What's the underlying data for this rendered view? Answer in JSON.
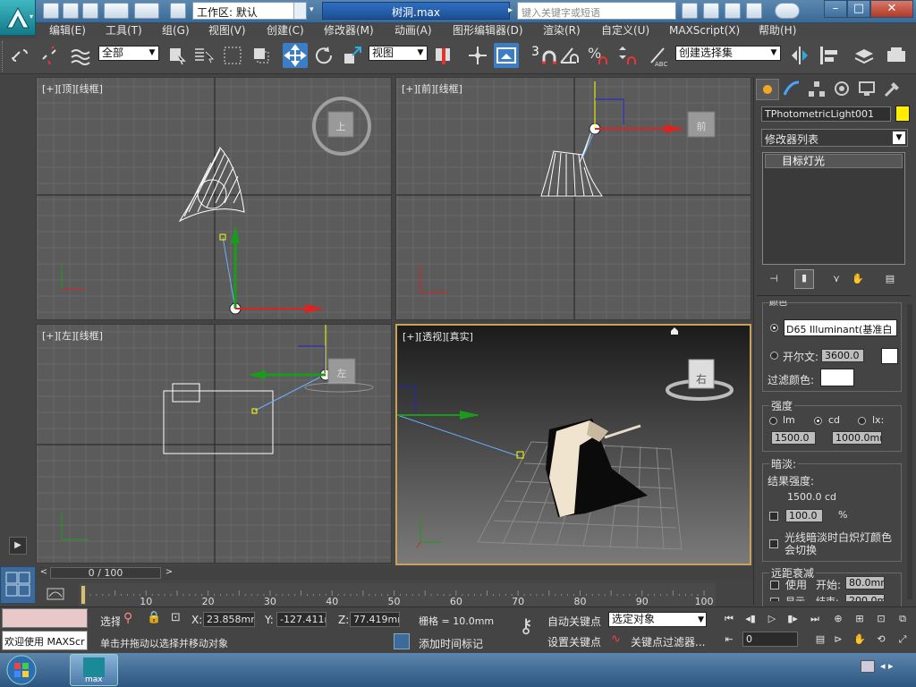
{
  "window": {
    "workspace_label": "工作区: 默认",
    "document_title": "树洞.max",
    "search_placeholder": "键入关键字或短语",
    "min": "–",
    "max": "□",
    "close": "✕"
  },
  "menu": [
    "编辑(E)",
    "工具(T)",
    "组(G)",
    "视图(V)",
    "创建(C)",
    "修改器(M)",
    "动画(A)",
    "图形编辑器(D)",
    "渲染(R)",
    "自定义(U)",
    "MAXScript(X)",
    "帮助(H)"
  ],
  "toolbar": {
    "selection_filter": "全部",
    "reference_coord": "视图",
    "named_selection_set": "创建选择集",
    "snap_number": "3"
  },
  "viewports": {
    "top": {
      "label": "[+][顶][线框]",
      "viewcube": "上"
    },
    "front": {
      "label": "[+][前][线框]",
      "viewcube": "前"
    },
    "left": {
      "label": "[+][左][线框]",
      "viewcube": "左"
    },
    "perspective": {
      "label": "[+][透视][真实]",
      "viewcube": "右"
    }
  },
  "command_panel": {
    "object_name": "TPhotometricLight001",
    "object_color": "#ffee00",
    "modifier_list": "修改器列表",
    "stack_item": "目标灯光",
    "color_rollout": "颜色",
    "preset_color": "D65 Illuminant(基准白",
    "kelvin_label": "开尔文:",
    "kelvin_value": "3600.0",
    "filter_color_label": "过滤颜色:",
    "intensity_rollout": "强度",
    "unit_lm": "lm",
    "unit_cd": "cd",
    "unit_lx": "lx:",
    "intensity_value": "1500.0",
    "distance_value": "1000.0mr",
    "dimming_rollout": "暗淡:",
    "result_label": "结果强度:",
    "result_value": "1500.0 cd",
    "percent_value": "100.0",
    "percent_unit": "%",
    "incandescent_label": "光线暗淡时白炽灯颜色会切换",
    "far_atten_rollout": "远距衰减",
    "use_label": "使用",
    "start_label": "开始:",
    "start_value": "80.0mm",
    "show_label": "显示",
    "end_label": "结束:",
    "end_value": "200.0mm"
  },
  "timeline": {
    "slider_text": "0 / 100",
    "ticks": [
      "10",
      "20",
      "30",
      "40",
      "50",
      "60",
      "70",
      "80",
      "90",
      "100"
    ]
  },
  "status": {
    "welcome": "欢迎使用 MAXScr",
    "select_mode": "选择",
    "x_label": "X:",
    "x_value": "23.858mm",
    "y_label": "Y:",
    "y_value": "-127.411m",
    "z_label": "Z:",
    "z_value": "77.419mm",
    "grid": "栅格 = 10.0mm",
    "prompt": "单击并拖动以选择并移动对象",
    "add_time_tag": "添加时间标记",
    "auto_key": "自动关键点",
    "set_key": "设置关键点",
    "selected_object": "选定对象",
    "key_filters": "关键点过滤器...",
    "frame_value": "0"
  },
  "taskbar": {
    "app_label": "max",
    "tray": "◂ ▸"
  }
}
